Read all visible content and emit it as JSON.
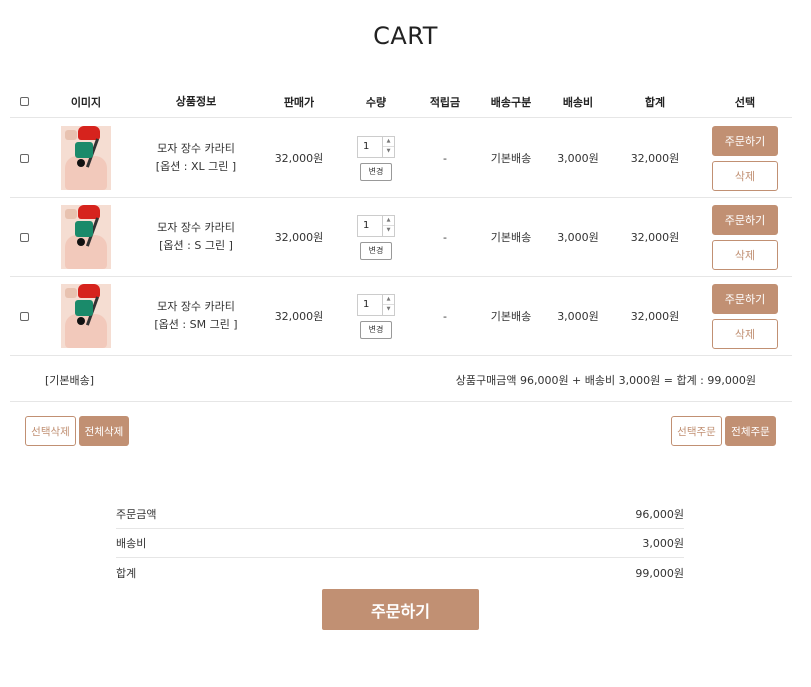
{
  "page_title": "CART",
  "headers": {
    "image": "이미지",
    "info": "상품정보",
    "price": "판매가",
    "qty": "수량",
    "points": "적립금",
    "ship_type": "배송구분",
    "ship_fee": "배송비",
    "total": "합계",
    "select": "선택"
  },
  "items": [
    {
      "name": "모자 장수 카라티",
      "option": "[옵션 : XL 그린 ]",
      "price": "32,000원",
      "qty": "1",
      "points": "-",
      "ship_type": "기본배송",
      "ship_fee": "3,000원",
      "total": "32,000원"
    },
    {
      "name": "모자 장수 카라티",
      "option": "[옵션 : S 그린 ]",
      "price": "32,000원",
      "qty": "1",
      "points": "-",
      "ship_type": "기본배송",
      "ship_fee": "3,000원",
      "total": "32,000원"
    },
    {
      "name": "모자 장수 카라티",
      "option": "[옵션 : SM 그린 ]",
      "price": "32,000원",
      "qty": "1",
      "points": "-",
      "ship_type": "기본배송",
      "ship_fee": "3,000원",
      "total": "32,000원"
    }
  ],
  "buttons": {
    "change": "변경",
    "order": "주문하기",
    "delete": "삭제",
    "delete_selected": "선택삭제",
    "delete_all": "전체삭제",
    "order_selected": "선택주문",
    "order_all": "전체주문",
    "order_main": "주문하기"
  },
  "group": {
    "label": "[기본배송]",
    "summary": "상품구매금액 96,000원 + 배송비 3,000원 = 합계 : 99,000원"
  },
  "summary": {
    "order_amount_label": "주문금액",
    "order_amount": "96,000원",
    "shipping_label": "배송비",
    "shipping": "3,000원",
    "total_label": "합계",
    "total": "99,000원"
  },
  "colors": {
    "accent": "#c19073"
  },
  "icons": {
    "spinner_up": "▲",
    "spinner_down": "▼"
  }
}
